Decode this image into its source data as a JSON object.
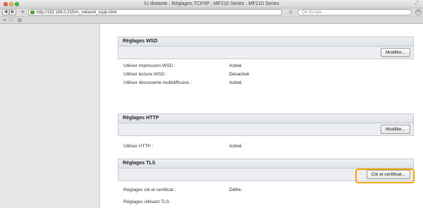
{
  "window": {
    "title": "IU distante : Réglages TCP/IP : MF210 Series : MF210 Series"
  },
  "toolbar": {
    "back_label": "◀",
    "forward_label": "▶",
    "add_label": "+",
    "url": "http://192.168.0.215/m_network_tcpip.html",
    "reload_label": "c",
    "search_placeholder": "Q▾ Google",
    "download_label": "⊙"
  },
  "bookmarks": {
    "reader_icon": "∞",
    "book_icon": "□",
    "grid_icon": "⊞"
  },
  "sections": {
    "wsd": {
      "title": "Réglages WSD",
      "button": "Modifier...",
      "rows": [
        {
          "label": "Utiliser impression WSD :",
          "value": "Activé"
        },
        {
          "label": "Utiliser lecture WSD :",
          "value": "Désactivé"
        },
        {
          "label": "Utiliser découverte multidiffusion :",
          "value": "Activé"
        }
      ]
    },
    "http": {
      "title": "Réglages HTTP",
      "button": "Modifier...",
      "rows": [
        {
          "label": "Utiliser HTTP :",
          "value": "Activé"
        }
      ]
    },
    "tls": {
      "title": "Réglages TLS",
      "button": "Clé et certificat...",
      "rows": [
        {
          "label": "Réglages clé et certificat :",
          "value": "Défini."
        },
        {
          "label": "Réglages utilisant TLS",
          "value": ""
        }
      ]
    }
  },
  "colors": {
    "highlight": "#f0a500"
  }
}
